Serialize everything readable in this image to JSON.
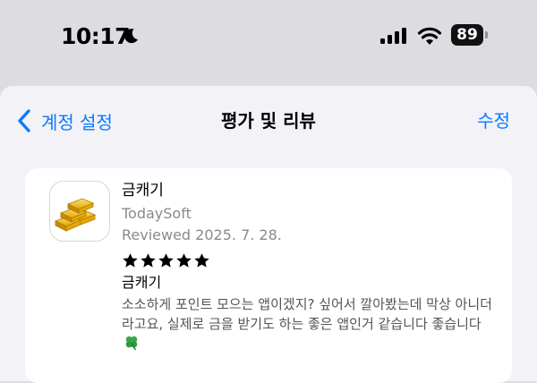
{
  "status_bar": {
    "time": "10:17",
    "battery": "89"
  },
  "nav": {
    "back_label": "계정 설정",
    "title": "평가 및 리뷰",
    "edit_label": "수정"
  },
  "review": {
    "app_name": "금캐기",
    "developer": "TodaySoft",
    "date": "Reviewed 2025. 7. 28.",
    "rating": 5,
    "title": "금캐기",
    "body": "소소하게 포인트 모으는 앱이겠지? 싶어서 깔아봤는데 막상 아니더라고요, 실제로 금을 받기도 하는 좋은 앱인거 같습니다 좋습니다"
  },
  "icons": {
    "moon": "moon-icon",
    "signal": "cellular-signal-icon",
    "wifi": "wifi-icon",
    "battery": "battery-icon",
    "back": "chevron-left-icon",
    "app": "gold-bars-icon",
    "star": "star-icon",
    "clover": "four-leaf-clover-icon"
  },
  "colors": {
    "accent": "#0a7aff",
    "background": "#f2f2f7",
    "card": "#ffffff",
    "secondary_text": "#8a8a8e"
  }
}
